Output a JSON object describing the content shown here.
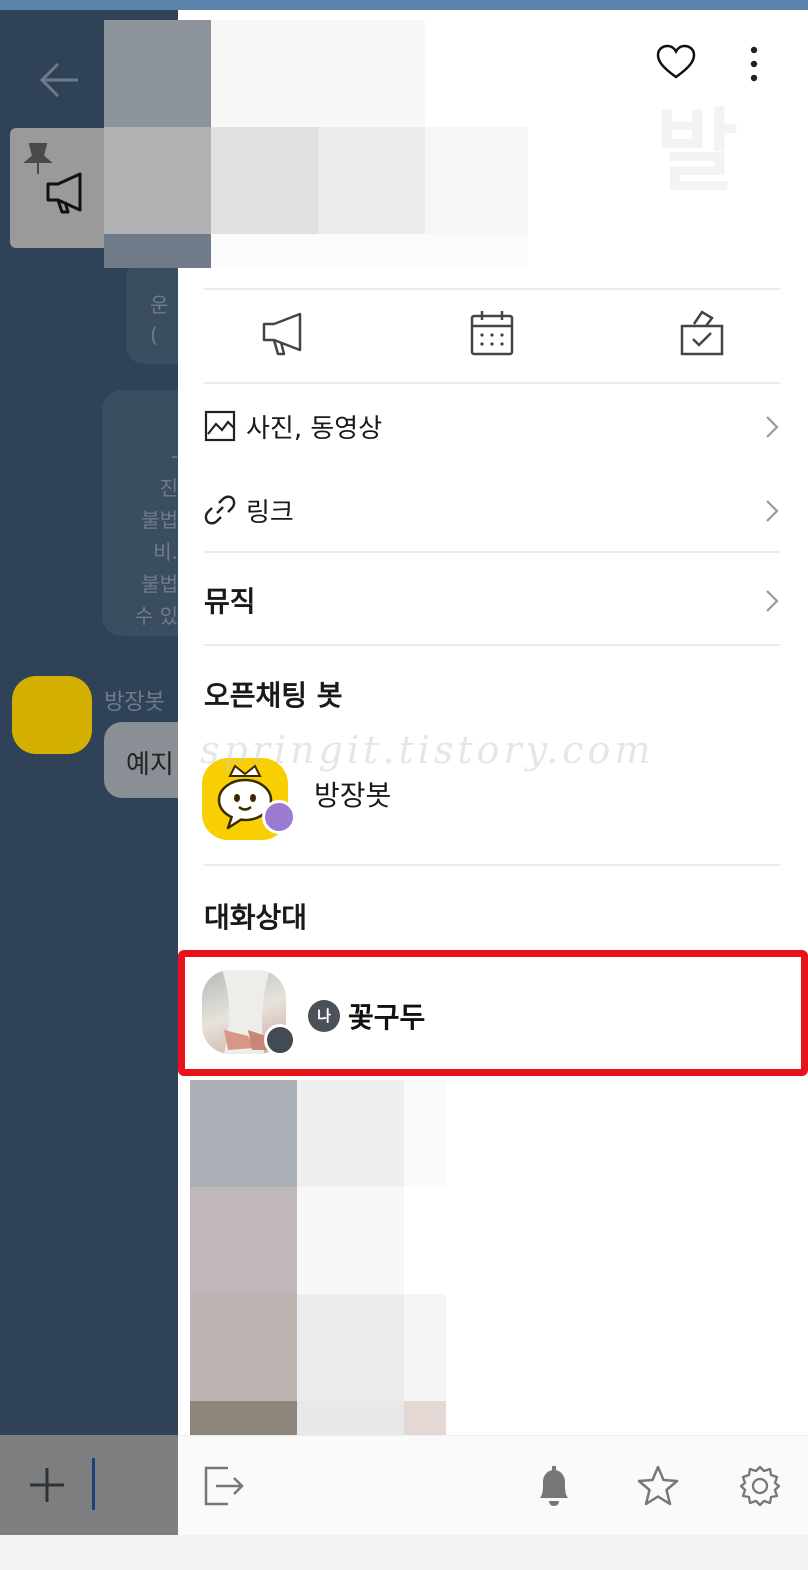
{
  "background_chat": {
    "bubble_a_lines": [
      "운",
      "("
    ],
    "bubble_b_lines": [
      "-",
      "진",
      "불법",
      "비.",
      "불법",
      "수 있"
    ],
    "sender_name": "방장봇",
    "message_fragment": "예지"
  },
  "drawer": {
    "menu": {
      "photos_label": "사진, 동영상",
      "links_label": "링크",
      "music_label": "뮤직"
    },
    "bot_section": {
      "title": "오픈채팅 봇",
      "bot_name": "방장봇"
    },
    "members_section": {
      "title": "대화상대",
      "me_badge": "나",
      "member_name": "꽃구두"
    },
    "watermark": "springit.tistory.com"
  },
  "colors": {
    "highlight": "#e8121a",
    "bot_yellow": "#f7cf02",
    "bot_badge": "#9b7ad1",
    "chat_bg": "#2f4257"
  },
  "icons": {
    "header": [
      "heart-icon",
      "more-vertical-icon"
    ],
    "quick_actions": [
      "megaphone-icon",
      "calendar-icon",
      "vote-icon"
    ],
    "footer": [
      "exit-icon",
      "bell-icon",
      "star-icon",
      "gear-icon"
    ]
  }
}
